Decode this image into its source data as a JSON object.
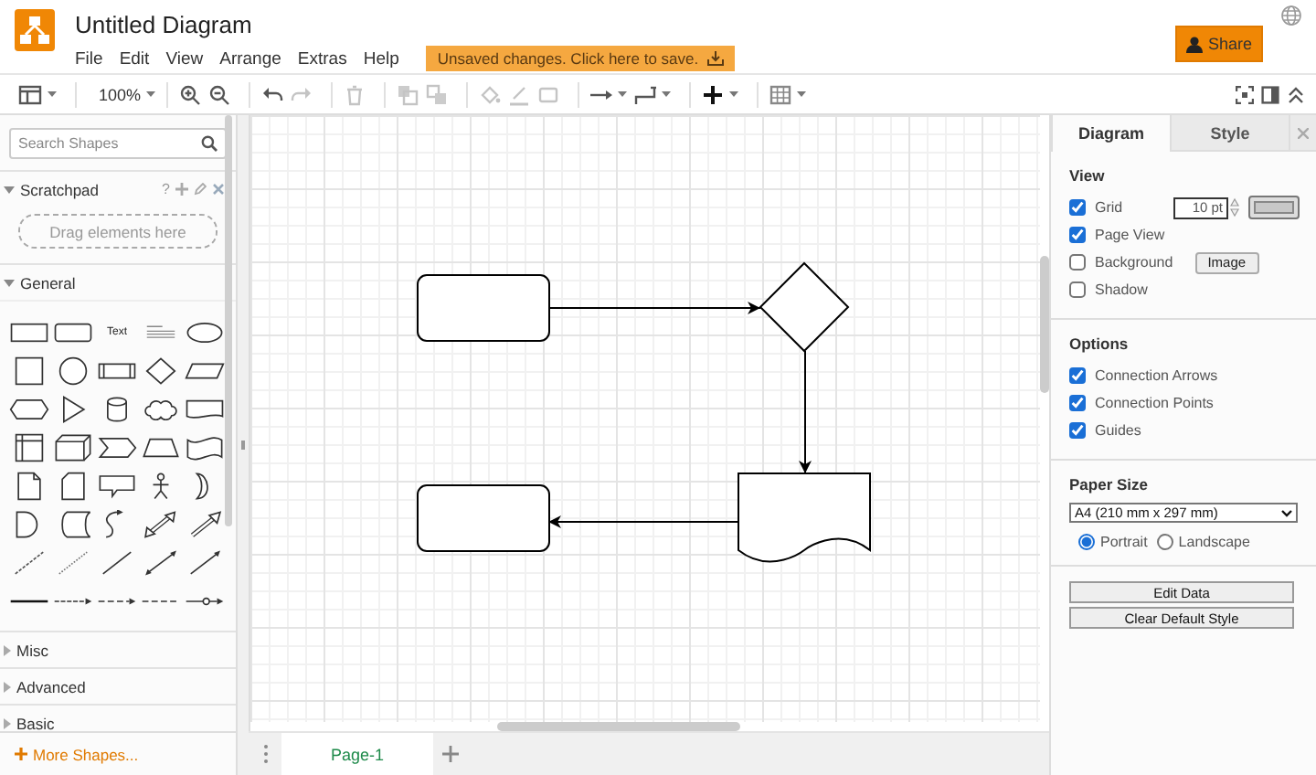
{
  "header": {
    "title": "Untitled Diagram",
    "menus": [
      "File",
      "Edit",
      "View",
      "Arrange",
      "Extras",
      "Help"
    ],
    "unsaved_notice": "Unsaved changes. Click here to save.",
    "share_button": "Share"
  },
  "toolbar": {
    "zoom": "100%"
  },
  "sidebar": {
    "search": {
      "placeholder": "Search Shapes"
    },
    "scratchpad": {
      "title": "Scratchpad",
      "expanded": true,
      "help": "?",
      "drop_hint": "Drag elements here"
    },
    "sections": [
      {
        "title": "General",
        "expanded": true
      },
      {
        "title": "Misc",
        "expanded": false
      },
      {
        "title": "Advanced",
        "expanded": false
      },
      {
        "title": "Basic",
        "expanded": false
      }
    ],
    "text_shape_label": "Text",
    "more_shapes": "More Shapes..."
  },
  "diagram": {
    "nodes": [
      {
        "kind": "rectangle",
        "arrow_to_next": true
      },
      {
        "kind": "diamond",
        "arrow_to_next": true
      },
      {
        "kind": "document",
        "arrow_to_next": true
      },
      {
        "kind": "rectangle",
        "arrow_to_next": false
      }
    ]
  },
  "pages": [
    {
      "label": "Page-1",
      "selected": true
    }
  ],
  "format_panel": {
    "tabs": [
      {
        "label": "Diagram",
        "selected": true
      },
      {
        "label": "Style",
        "selected": false
      }
    ],
    "view": {
      "title": "View",
      "options": [
        {
          "label": "Grid",
          "checked": true
        },
        {
          "label": "Page View",
          "checked": true
        },
        {
          "label": "Background",
          "checked": false
        },
        {
          "label": "Shadow",
          "checked": false
        }
      ],
      "grid_size": "10 pt",
      "image_button": "Image"
    },
    "options": {
      "title": "Options",
      "items": [
        {
          "label": "Connection Arrows",
          "checked": true
        },
        {
          "label": "Connection Points",
          "checked": true
        },
        {
          "label": "Guides",
          "checked": true
        }
      ]
    },
    "paper": {
      "title": "Paper Size",
      "size": "A4 (210 mm x 297 mm)",
      "orientations": [
        {
          "label": "Portrait",
          "selected": true
        },
        {
          "label": "Landscape",
          "selected": false
        }
      ]
    },
    "buttons": [
      "Edit Data",
      "Clear Default Style"
    ]
  }
}
